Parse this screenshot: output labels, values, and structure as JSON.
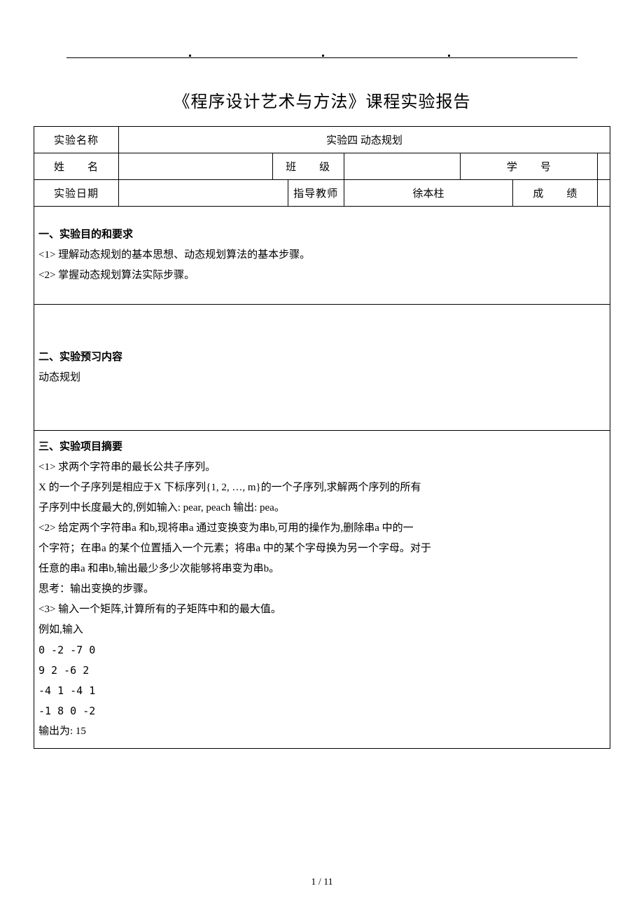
{
  "title": "《程序设计艺术与方法》课程实验报告",
  "row1": {
    "label_exp_name": "实验名称",
    "exp_name_value": "实验四  动态规划"
  },
  "row2": {
    "label_name": "姓　　名",
    "name_value": "",
    "label_class": "班　　级",
    "class_value": "",
    "label_student_id": "学　　号",
    "student_id_value": ""
  },
  "row3": {
    "label_date": "实验日期",
    "date_value": "",
    "label_instructor": "指导教师",
    "instructor_value": "徐本柱",
    "label_grade": "成　　绩",
    "grade_value": ""
  },
  "section1": {
    "heading": "一、实验目的和要求",
    "line1": "<1> 理解动态规划的基本思想、动态规划算法的基本步骤。",
    "line2": "<2> 掌握动态规划算法实际步骤。"
  },
  "section2": {
    "heading": "二、实验预习内容",
    "line1": "动态规划"
  },
  "section3": {
    "heading": "三、实验项目摘要",
    "line1": "<1> 求两个字符串的最长公共子序列。",
    "line2": "X 的一个子序列是相应于X 下标序列{1, 2, …, m}的一个子序列,求解两个序列的所有",
    "line3": "子序列中长度最大的,例如输入: pear, peach 输出: pea。",
    "line4": "<2> 给定两个字符串a 和b,现将串a 通过变换变为串b,可用的操作为,删除串a 中的一",
    "line5": "个字符；在串a 的某个位置插入一个元素；将串a 中的某个字母换为另一个字母。对于",
    "line6": "任意的串a 和串b,输出最少多少次能够将串变为串b。",
    "line7": "思考：输出变换的步骤。",
    "line8": "<3> 输入一个矩阵,计算所有的子矩阵中和的最大值。",
    "line9": "例如,输入",
    "matrix1": "0 -2 -7 0",
    "matrix2": "9 2 -6 2",
    "matrix3": "-4 1 -4 1",
    "matrix4": "-1 8 0 -2",
    "line_output": "输出为: 15"
  },
  "page_number": "1 / 11"
}
